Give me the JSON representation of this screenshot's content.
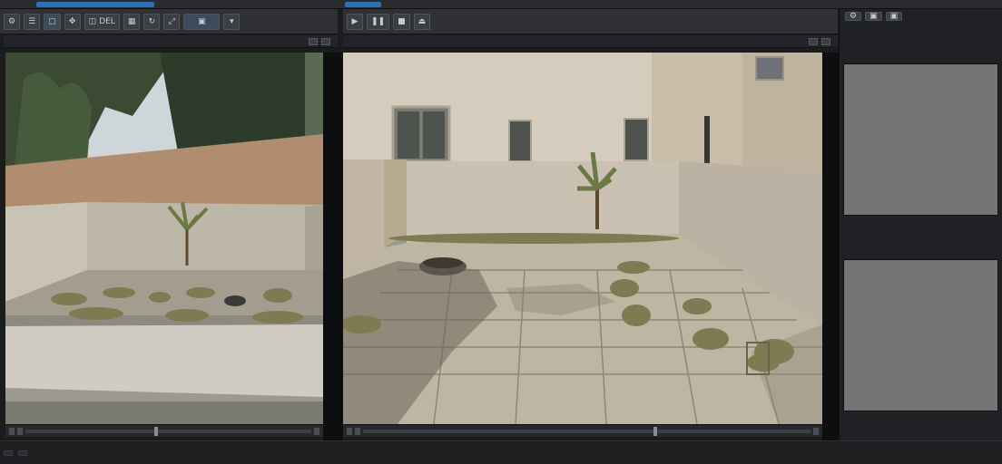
{
  "window": {
    "accent_color": "#2f6fb7"
  },
  "left_toolbar": {
    "buttons": [
      {
        "icon": "gear-icon",
        "label": ""
      },
      {
        "icon": "menu-icon",
        "label": ""
      },
      {
        "icon": "select-icon",
        "label": ""
      },
      {
        "icon": "move-icon",
        "label": ""
      },
      {
        "icon": "snap-icon",
        "label": "DEL"
      },
      {
        "icon": "grid-icon",
        "label": ""
      },
      {
        "icon": "rotate-icon",
        "label": ""
      },
      {
        "icon": "scale-icon",
        "label": ""
      },
      {
        "icon": "camera-icon",
        "label": ""
      },
      {
        "icon": "settings-icon",
        "label": ""
      }
    ]
  },
  "center_toolbar": {
    "buttons": [
      {
        "icon": "play-icon",
        "label": ""
      },
      {
        "icon": "pause-icon",
        "label": ""
      },
      {
        "icon": "stop-icon",
        "label": ""
      },
      {
        "icon": "eject-icon",
        "label": ""
      }
    ]
  },
  "left_viewport": {
    "header_left": "",
    "header_right": ""
  },
  "center_viewport": {
    "header_left": "",
    "header_right": ""
  },
  "right_panel": {
    "title": "",
    "section_1": "",
    "section_2": "",
    "section_3": "",
    "section_4": "",
    "section_5": ""
  },
  "status_bar": {
    "item_1": "",
    "item_2": ""
  }
}
